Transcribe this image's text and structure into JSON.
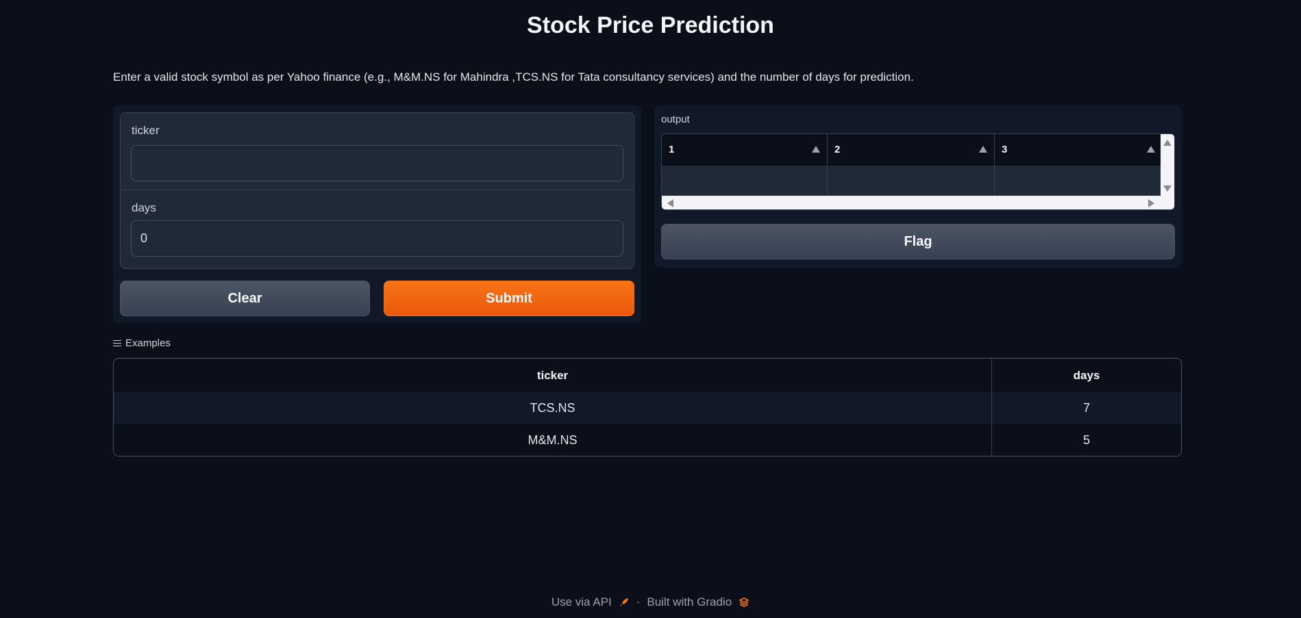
{
  "header": {
    "title": "Stock Price Prediction",
    "description": "Enter a valid stock symbol as per Yahoo finance (e.g., M&M.NS for Mahindra ,TCS.NS for Tata consultancy services) and the number of days for prediction."
  },
  "inputs": {
    "ticker": {
      "label": "ticker",
      "value": "",
      "placeholder": ""
    },
    "days": {
      "label": "days",
      "value": "0"
    }
  },
  "buttons": {
    "clear": "Clear",
    "submit": "Submit",
    "flag": "Flag"
  },
  "output": {
    "label": "output",
    "columns": [
      "1",
      "2",
      "3"
    ],
    "rows": [
      [
        "",
        "",
        ""
      ]
    ]
  },
  "examples": {
    "label": "Examples",
    "headers": [
      "ticker",
      "days"
    ],
    "rows": [
      [
        "TCS.NS",
        "7"
      ],
      [
        "M&M.NS",
        "5"
      ]
    ]
  },
  "footer": {
    "api_link": "Use via API",
    "separator": "·",
    "built_with": "Built with Gradio"
  },
  "colors": {
    "background": "#0b0f19",
    "panel": "#111827",
    "accent": "#f97316",
    "secondary_button": "#4b5563"
  },
  "icons": {
    "api": "rocket-icon",
    "gradio": "gradio-logo-icon",
    "examples": "list-icon",
    "sort": "sort-arrow-icon"
  }
}
